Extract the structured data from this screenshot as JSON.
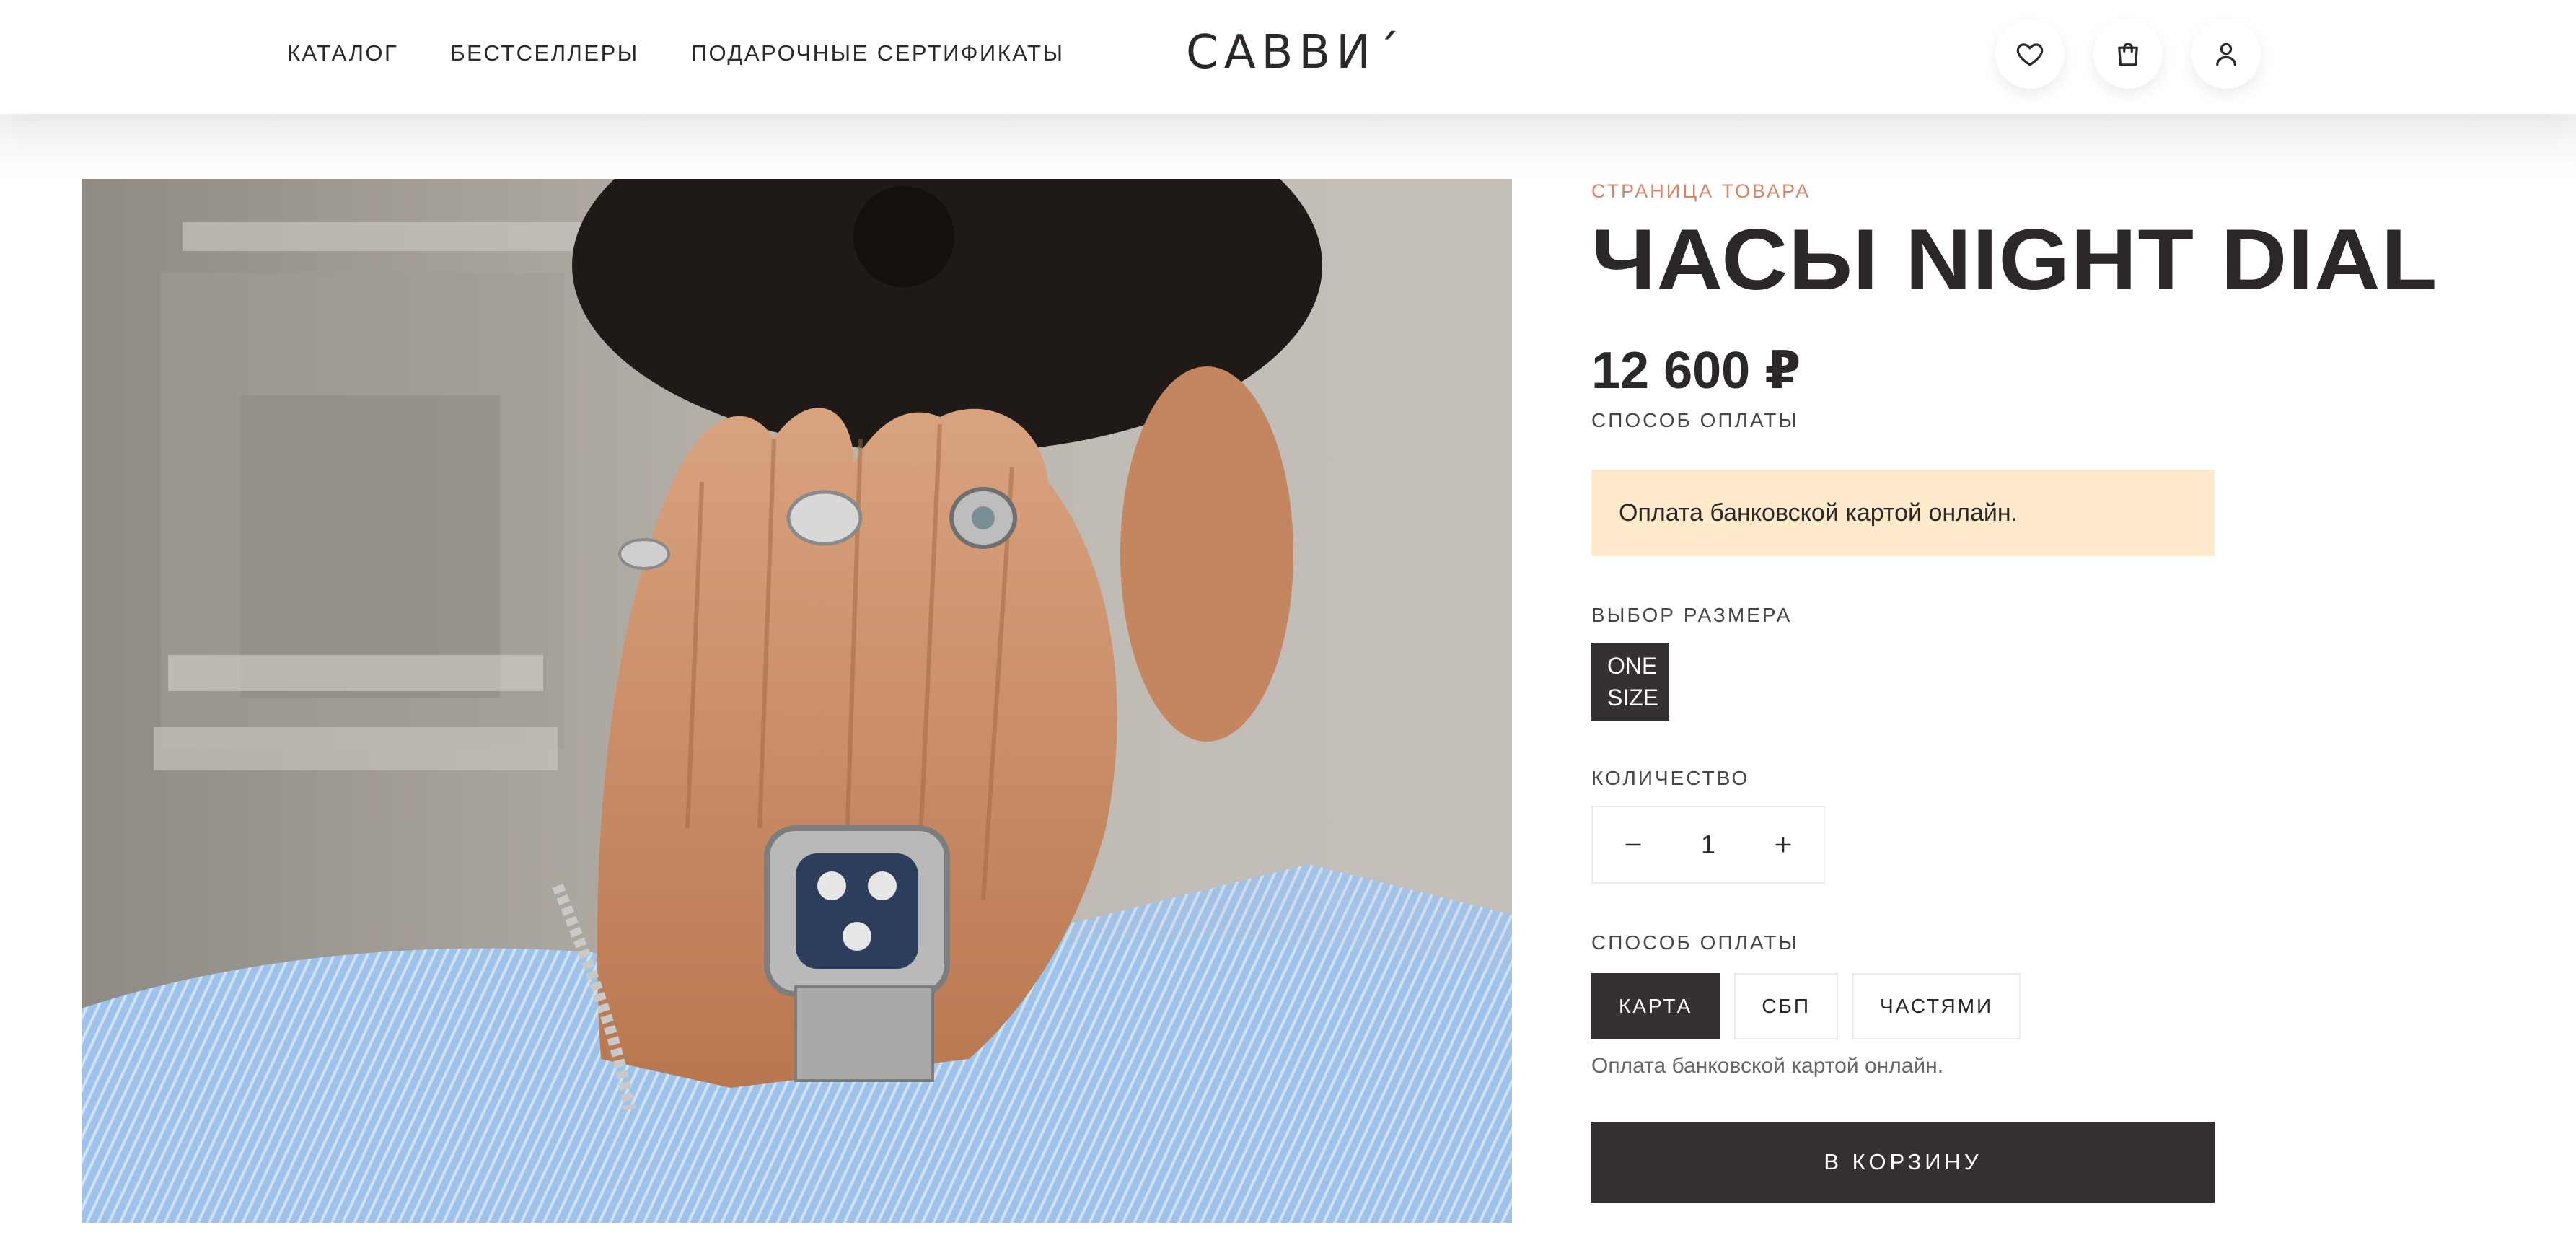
{
  "header": {
    "nav": [
      {
        "label": "КАТАЛОГ"
      },
      {
        "label": "БЕСТСЕЛЛЕРЫ"
      },
      {
        "label": "ПОДАРОЧНЫЕ СЕРТИФИКАТЫ"
      }
    ],
    "logo": "САВВИ´",
    "icons": [
      "heart-icon",
      "shopping-bag-icon",
      "user-icon"
    ]
  },
  "product": {
    "breadcrumb": "СТРАНИЦА ТОВАРА",
    "title": "ЧАСЫ NIGHT DIAL",
    "price": "12 600 ₽",
    "payment_label": "СПОСОБ ОПЛАТЫ",
    "notice": "Оплата банковской картой онлайн.",
    "size_label": "ВЫБОР РАЗМЕРА",
    "size_option": {
      "line1": "ONE",
      "line2": "SIZE"
    },
    "quantity_label": "КОЛИЧЕСТВО",
    "quantity": "1",
    "payment_label_2": "СПОСОБ ОПЛАТЫ",
    "payment_options": [
      {
        "label": "КАРТА",
        "selected": true
      },
      {
        "label": "СБП",
        "selected": false
      },
      {
        "label": "ЧАСТЯМИ",
        "selected": false
      }
    ],
    "payment_note": "Оплата банковской картой онлайн.",
    "add_to_cart": "В КОРЗИНУ"
  },
  "colors": {
    "text": "#2b2827",
    "accent": "#d98467",
    "dark_button": "#353131",
    "notice_bg": "#ffeacc"
  }
}
